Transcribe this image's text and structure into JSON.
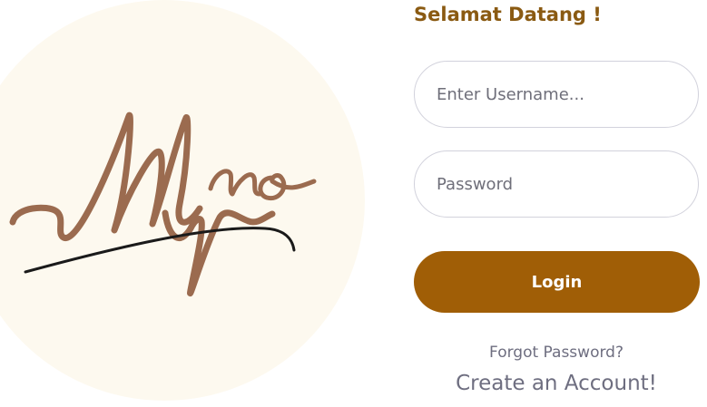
{
  "logo": {
    "icon": "myno-signature-logo",
    "circle_color": "#fdf9ef",
    "ink_color": "#9b6b4f",
    "underline_color": "#1a1a1a"
  },
  "login_form": {
    "welcome_title": "Selamat Datang !",
    "username_placeholder": "Enter Username...",
    "password_placeholder": "Password",
    "login_label": "Login",
    "forgot_password_label": "Forgot Password?",
    "create_account_label": "Create an Account!",
    "accent_color": "#a05e06",
    "title_color": "#8a5a12"
  }
}
